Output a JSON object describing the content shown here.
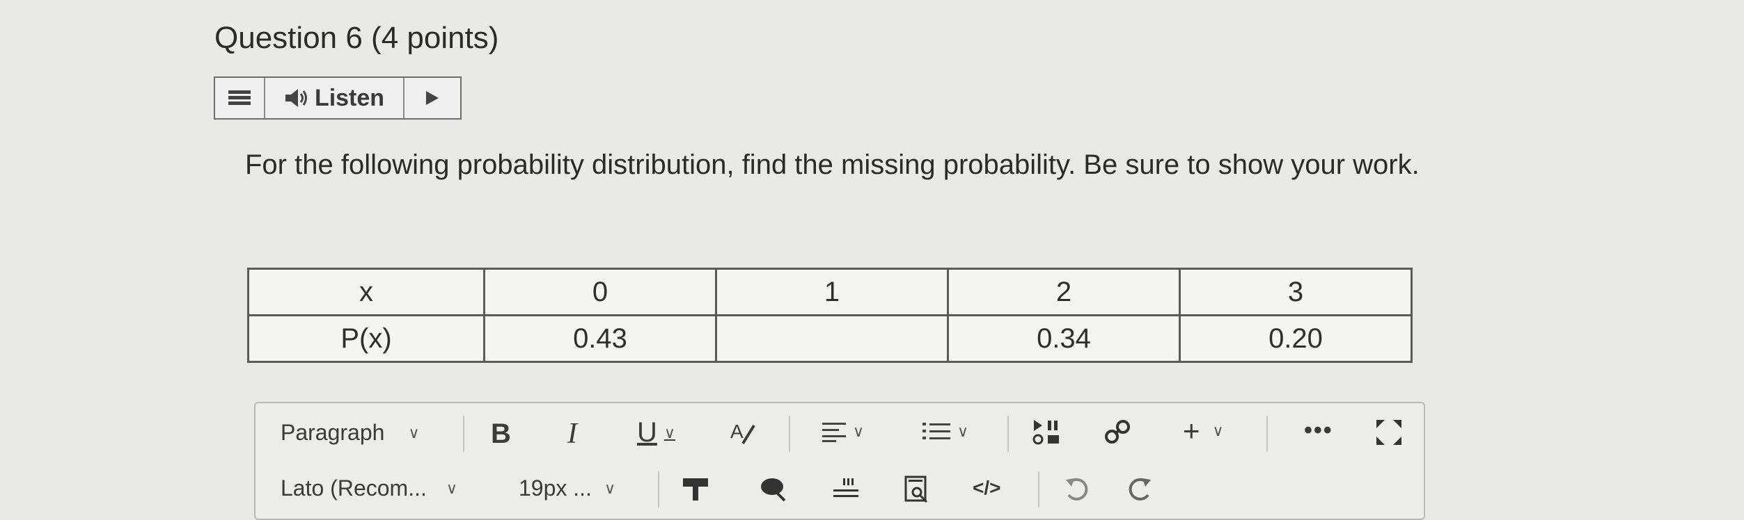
{
  "question": {
    "title": "Question 6",
    "points": "(4 points)"
  },
  "listen_bar": {
    "listen_label": "Listen"
  },
  "prompt": "For the following probability distribution, find the missing probability. Be sure to show your work.",
  "table": {
    "rows": [
      [
        "x",
        "0",
        "1",
        "2",
        "3"
      ],
      [
        "P(x)",
        "0.43",
        "",
        "0.34",
        "0.20"
      ]
    ]
  },
  "editor": {
    "block_format": "Paragraph",
    "font_family": "Lato (Recom...",
    "font_size": "19px ...",
    "toolbar_icons": [
      "bold-icon",
      "italic-icon",
      "underline-icon",
      "text-color-icon",
      "align-icon",
      "list-icon",
      "media-icon",
      "link-icon",
      "plus-icon",
      "more-icon",
      "fullscreen-icon",
      "highlight-icon",
      "spellcheck-icon",
      "word-count-icon",
      "find-replace-icon",
      "html-code-icon",
      "undo-icon",
      "redo-icon"
    ]
  }
}
